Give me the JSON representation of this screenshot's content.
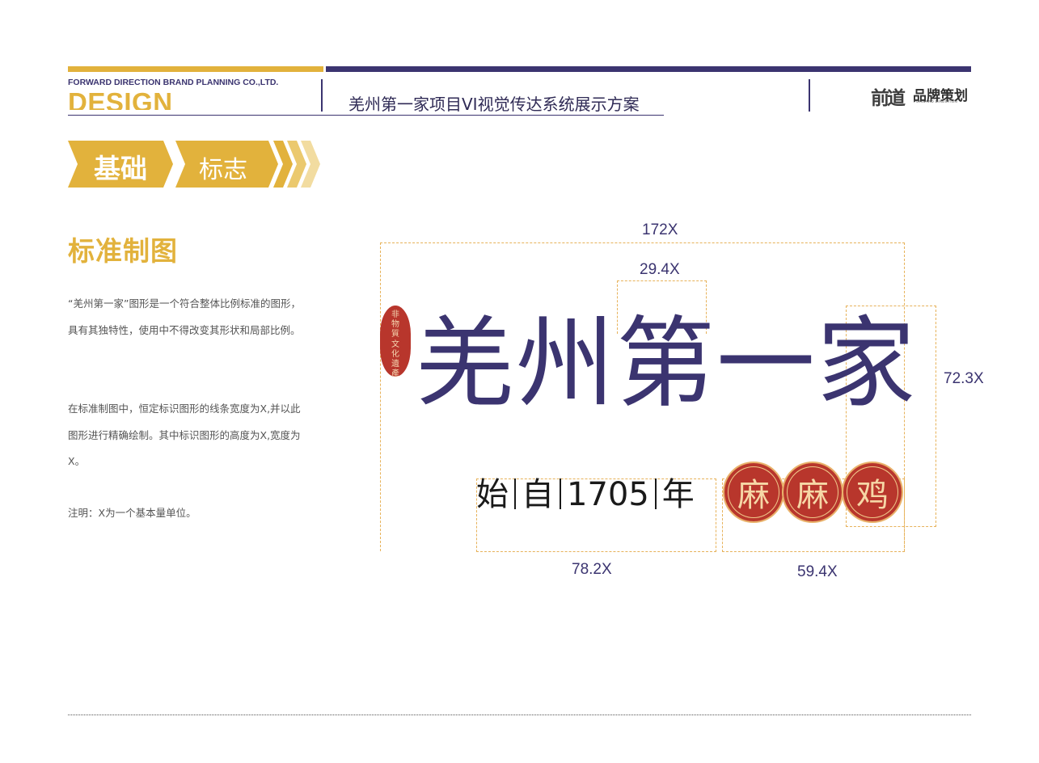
{
  "header": {
    "company": "FORWARD DIRECTION BRAND PLANNING CO.,LTD.",
    "design": "DESIGN",
    "project_title": "羌州第一家项目VI视觉传达系统展示方案",
    "logo_mark": "前道",
    "logo_name": "品牌策划",
    "logo_en": "FORWARD DIRECTION"
  },
  "banner": {
    "primary": "基础",
    "secondary": "标志"
  },
  "left": {
    "heading": "标准制图",
    "para1": "“羌州第一家”图形是一个符合整体比例标准的图形，具有其独特性，使用中不得改变其形状和局部比例。",
    "para2": "在标准制图中，恒定标识图形的线条宽度为X,并以此图形进行精确绘制。其中标识图形的高度为X,宽度为　X。",
    "note": "注明：X为一个基本量单位。"
  },
  "drawing": {
    "logo_text": "羌州第一家",
    "seal_chars": [
      "非",
      "物",
      "質",
      "文",
      "化",
      "遺",
      "產"
    ],
    "slogan_parts": [
      "始",
      "自",
      "1705",
      "年"
    ],
    "badge_chars": [
      "麻",
      "麻",
      "鸡"
    ],
    "dims": {
      "total_width": "172X",
      "glyph_width": "29.4X",
      "height": "72.3X",
      "slogan_width": "78.2X",
      "badge_width": "59.4X"
    }
  },
  "colors": {
    "navy": "#3b3470",
    "gold": "#e2b23c",
    "red": "#b8362c",
    "guide": "#e7b25a"
  }
}
